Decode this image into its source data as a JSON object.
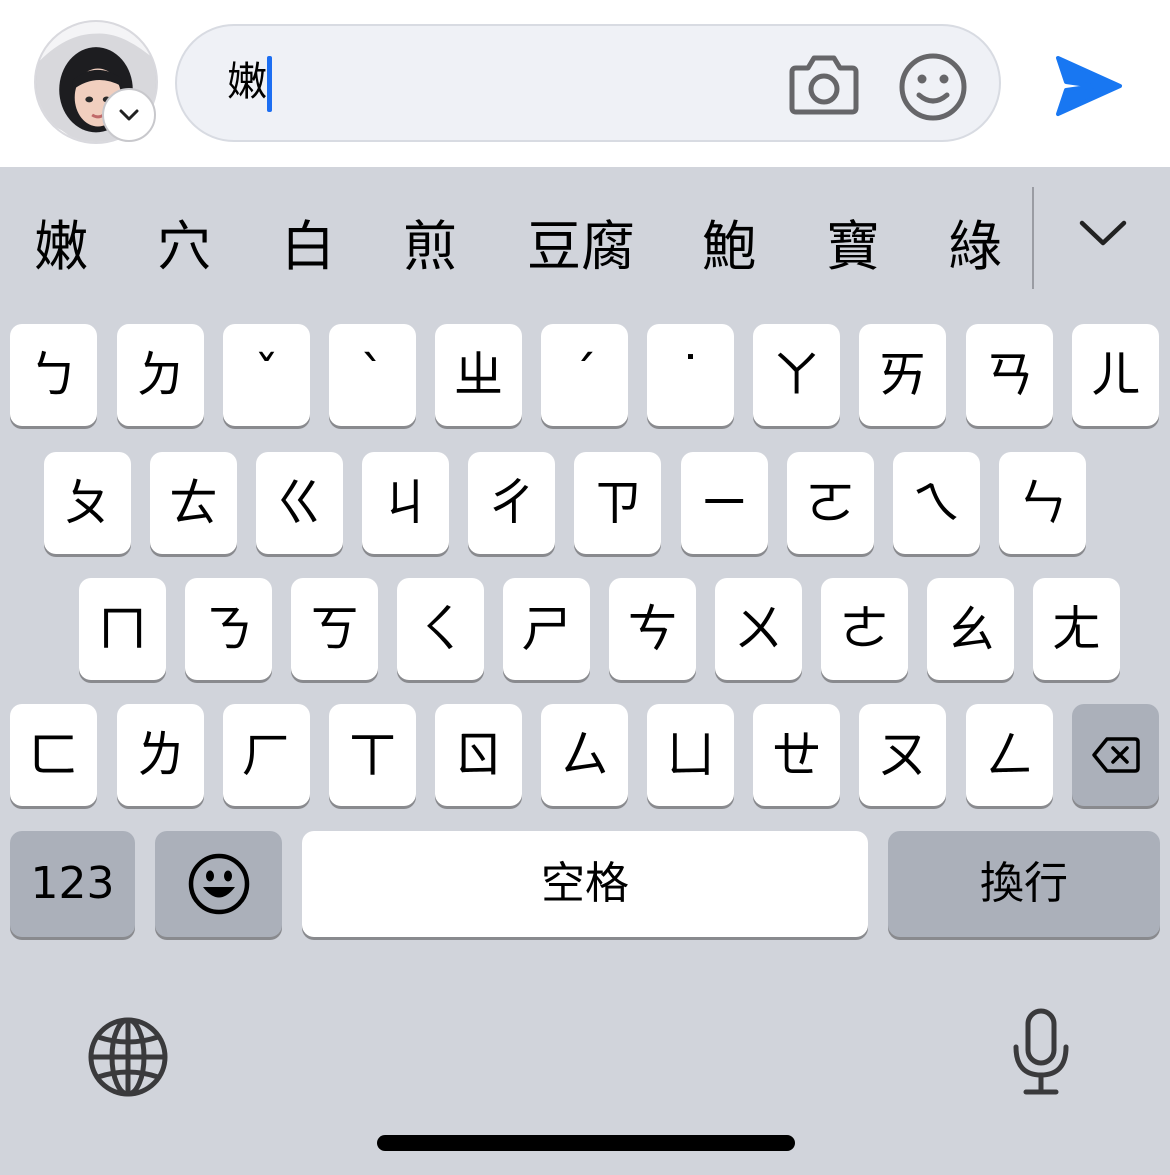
{
  "compose": {
    "input_value": "嫩"
  },
  "candidates": {
    "items": [
      "嫩",
      "穴",
      "白",
      "煎",
      "豆腐",
      "鮑",
      "寶",
      "綠"
    ]
  },
  "keyboard": {
    "row1": [
      "ㄅ",
      "ㄉ",
      "ˇ",
      "ˋ",
      "ㄓ",
      "ˊ",
      "˙",
      "ㄚ",
      "ㄞ",
      "ㄢ",
      "ㄦ"
    ],
    "row2": [
      "ㄆ",
      "ㄊ",
      "ㄍ",
      "ㄐ",
      "ㄔ",
      "ㄗ",
      "ㄧ",
      "ㄛ",
      "ㄟ",
      "ㄣ"
    ],
    "row3": [
      "ㄇ",
      "ㄋ",
      "ㄎ",
      "ㄑ",
      "ㄕ",
      "ㄘ",
      "ㄨ",
      "ㄜ",
      "ㄠ",
      "ㄤ"
    ],
    "row4": [
      "ㄈ",
      "ㄌ",
      "ㄏ",
      "ㄒ",
      "ㄖ",
      "ㄙ",
      "ㄩ",
      "ㄝ",
      "ㄡ",
      "ㄥ"
    ],
    "numbers_label": "123",
    "space_label": "空格",
    "return_label": "換行"
  },
  "colors": {
    "accent": "#1c6ef2",
    "send": "#1877f2",
    "keyboard_bg": "#d1d4db",
    "key_bg": "#ffffff",
    "special_key_bg": "#abb0ba"
  },
  "icons": {
    "avatar_badge": "chevron-down-icon",
    "camera": "camera-icon",
    "emoji": "smiley-icon",
    "send": "send-icon",
    "candidates_expand": "chevron-down-icon",
    "delete": "backspace-icon",
    "emoji_key": "emoji-icon",
    "globe": "globe-icon",
    "mic": "microphone-icon"
  }
}
